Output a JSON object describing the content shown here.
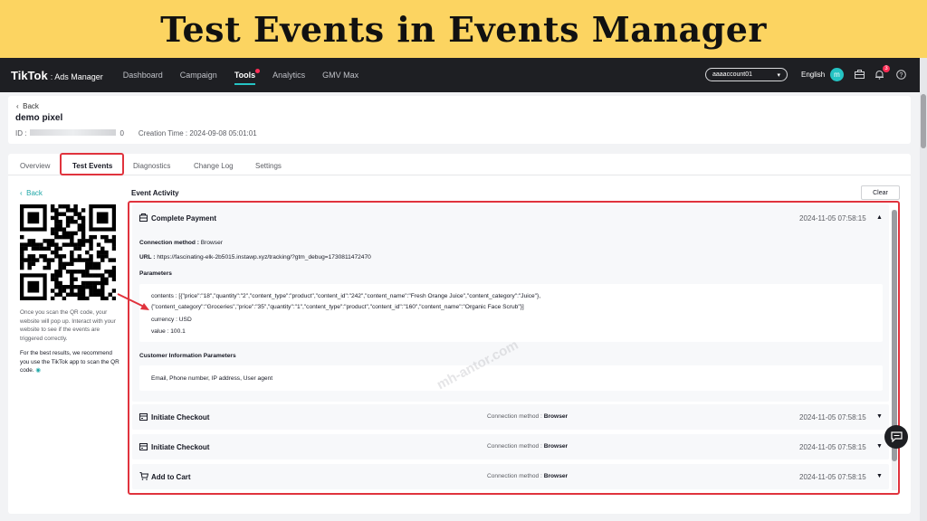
{
  "banner": {
    "title": "Test Events in Events Manager"
  },
  "nav": {
    "logo": "TikTok",
    "logo_sub": ": Ads Manager",
    "items": [
      "Dashboard",
      "Campaign",
      "Tools",
      "Analytics",
      "GMV Max"
    ],
    "account": "aaaaccount01",
    "language": "English",
    "avatar": "m",
    "notification_count": "3"
  },
  "pixel": {
    "back": "Back",
    "name": "demo pixel",
    "id_label": "ID :",
    "id_suffix": "0",
    "creation_time_label": "Creation Time :",
    "creation_time": "2024-09-08 05:01:01"
  },
  "tabs": [
    "Overview",
    "Test Events",
    "Diagnostics",
    "Change Log",
    "Settings"
  ],
  "left_panel": {
    "back": "Back",
    "note": "Once you scan the QR code, your website will pop up. Interact with your website to see if the events are triggered correctly.",
    "note2": "For the best results, we recommend you use the TikTok app to scan the QR code."
  },
  "activity": {
    "title": "Event Activity",
    "clear": "Clear",
    "expanded": {
      "name": "Complete Payment",
      "time": "2024-11-05 07:58:15",
      "connection_label": "Connection method :",
      "connection": "Browser",
      "url_label": "URL :",
      "url": "https://fascinating-elk-2b5015.instawp.xyz/tracking/?gtm_debug=1730811472470",
      "parameters_label": "Parameters",
      "contents_line1": "contents : [{\"price\":\"18\",\"quantity\":\"2\",\"content_type\":\"product\",\"content_id\":\"242\",\"content_name\":\"Fresh Orange Juice\",\"content_category\":\"Juice\"},",
      "contents_line2": "{\"content_category\":\"Groceries\",\"price\":\"35\",\"quantity\":\"1\",\"content_type\":\"product\",\"content_id\":\"160\",\"content_name\":\"Organic Face Scrub\"}]",
      "currency": "currency : USD",
      "value": "value : 100.1",
      "customer_label": "Customer Information Parameters",
      "customer_values": "Email, Phone number, IP address, User agent"
    },
    "events": [
      {
        "name": "Initiate Checkout",
        "connection_label": "Connection method :",
        "connection": "Browser",
        "time": "2024-11-05 07:58:15"
      },
      {
        "name": "Initiate Checkout",
        "connection_label": "Connection method :",
        "connection": "Browser",
        "time": "2024-11-05 07:58:15"
      },
      {
        "name": "Add to Cart",
        "connection_label": "Connection method :",
        "connection": "Browser",
        "time": "2024-11-05 07:58:15"
      }
    ]
  },
  "watermark": "mh-antor.com"
}
